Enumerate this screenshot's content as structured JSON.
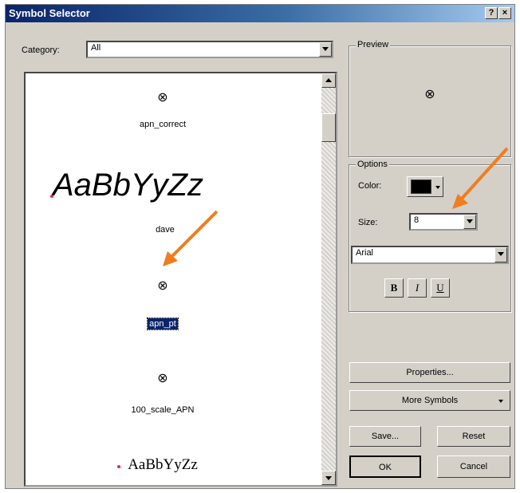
{
  "window": {
    "title": "Symbol Selector",
    "help_label": "?",
    "close_label": "×"
  },
  "category": {
    "label": "Category:",
    "value": "All"
  },
  "symbols": [
    {
      "icon": "⊗",
      "name": "apn_correct"
    },
    {
      "sample_text": "AaBbYyZz",
      "name": "dave"
    },
    {
      "icon": "⊗",
      "name": "apn_pt"
    },
    {
      "icon": "⊗",
      "name": "100_scale_APN"
    },
    {
      "sample_text": "AaBbYyZz"
    }
  ],
  "preview": {
    "label": "Preview",
    "icon": "⊗"
  },
  "options": {
    "label": "Options",
    "color_label": "Color:",
    "color_value": "#000000",
    "size_label": "Size:",
    "size_value": "8",
    "font_value": "Arial",
    "bold_label": "B",
    "italic_label": "I",
    "underline_label": "U"
  },
  "buttons": {
    "properties": "Properties...",
    "more_symbols": "More Symbols",
    "save": "Save...",
    "reset": "Reset",
    "ok": "OK",
    "cancel": "Cancel"
  },
  "annotation_color": "#f07d1e",
  "selection_color": "#0a246a"
}
